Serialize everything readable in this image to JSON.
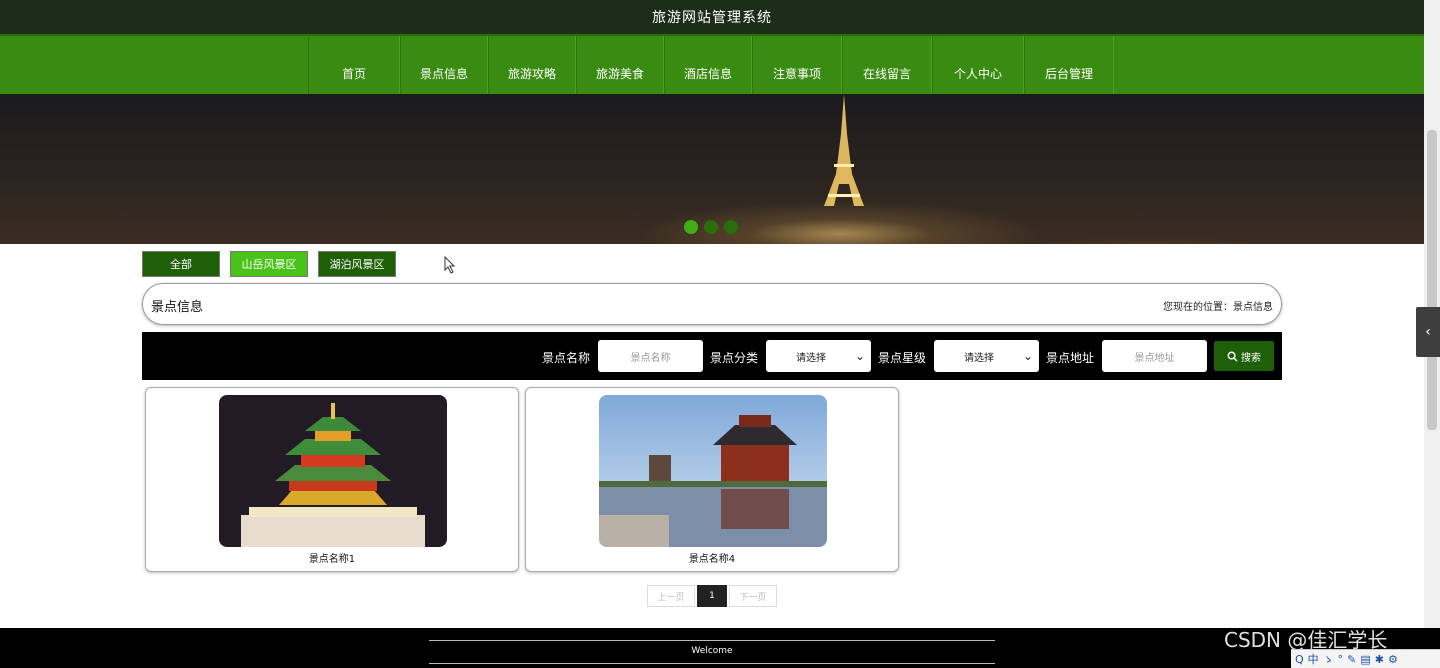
{
  "header": {
    "title": "旅游网站管理系统"
  },
  "nav": {
    "items": [
      "首页",
      "景点信息",
      "旅游攻略",
      "旅游美食",
      "酒店信息",
      "注意事项",
      "在线留言",
      "个人中心",
      "后台管理"
    ]
  },
  "banner": {
    "dot_count": 3,
    "active_dot": 1
  },
  "filters": {
    "items": [
      "全部",
      "山岳风景区",
      "湖泊风景区"
    ]
  },
  "section": {
    "title": "景点信息",
    "breadcrumb": "您现在的位置：景点信息"
  },
  "search": {
    "name_label": "景点名称",
    "name_placeholder": "景点名称",
    "category_label": "景点分类",
    "category_value": "请选择",
    "level_label": "景点星级",
    "level_value": "请选择",
    "address_label": "景点地址",
    "address_placeholder": "景点地址",
    "button_label": "搜索"
  },
  "cards": [
    {
      "name": "景点名称1"
    },
    {
      "name": "景点名称4"
    }
  ],
  "pagination": {
    "prev": "上一页",
    "current": "1",
    "next": "下一页"
  },
  "footer": {
    "text": "Welcome"
  },
  "watermark": "CSDN @佳汇学长",
  "tray": {
    "items": [
      "Q",
      "中",
      "ゝ",
      "°",
      "✎",
      "▤",
      "✱",
      "⚙"
    ]
  },
  "colors": {
    "topbar": "#1c2e1a",
    "nav": "#3a8b12",
    "button_dark": "#1e5f07",
    "button_light": "#49c21a",
    "dot_active": "#3fae14",
    "search_bar": "#000000"
  }
}
